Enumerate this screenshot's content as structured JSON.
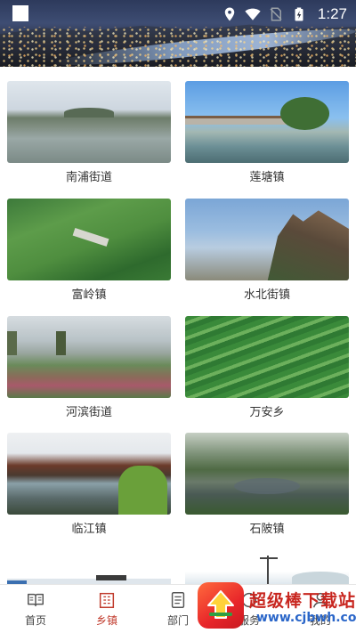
{
  "status_bar": {
    "time": "1:27",
    "icons": [
      "location-icon",
      "wifi-icon",
      "no-sim-icon",
      "battery-charging-icon"
    ]
  },
  "banner": {
    "image": "city-night-panorama"
  },
  "towns": [
    {
      "name": "南浦街道",
      "image": "lake-with-hills"
    },
    {
      "name": "莲塘镇",
      "image": "covered-bridge-over-river"
    },
    {
      "name": "富岭镇",
      "image": "green-mountain-valley"
    },
    {
      "name": "水北街镇",
      "image": "rocky-cliff-peak"
    },
    {
      "name": "河滨街道",
      "image": "riverside-willows-flowers"
    },
    {
      "name": "万安乡",
      "image": "terraced-fields"
    },
    {
      "name": "临江镇",
      "image": "long-covered-bridge"
    },
    {
      "name": "石陂镇",
      "image": "aerial-village-view"
    }
  ],
  "bottom_nav": {
    "active": "乡镇",
    "items": [
      {
        "label": "首页",
        "icon": "book-open-icon"
      },
      {
        "label": "乡镇",
        "icon": "building-icon"
      },
      {
        "label": "部门",
        "icon": "document-list-icon"
      },
      {
        "label": "服务",
        "icon": "service-icon"
      },
      {
        "label": "我的",
        "icon": "user-icon"
      }
    ]
  },
  "watermark": {
    "title": "超级棒下载站",
    "url": "www.cjbwh.com",
    "colors": {
      "badge": "#e8262a",
      "title": "#c8261f",
      "url": "#2a66c9"
    }
  },
  "colors": {
    "accent": "#c0392b",
    "nav_text": "#444444",
    "label_text": "#333333"
  }
}
